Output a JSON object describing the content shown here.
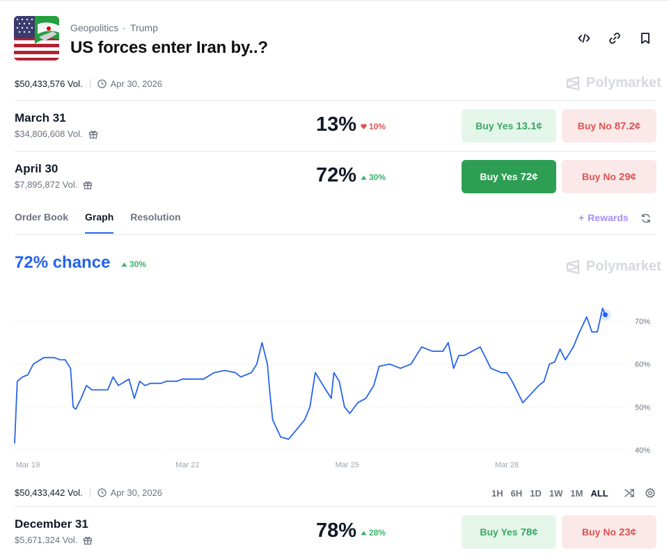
{
  "header": {
    "breadcrumb": [
      "Geopolitics",
      "Trump"
    ],
    "breadcrumb_separator": "·",
    "title": "US forces enter Iran by..?",
    "icons": [
      "embed-icon",
      "link-icon",
      "bookmark-icon"
    ]
  },
  "summary": {
    "volume": "$50,433,576 Vol.",
    "end_date": "Apr 30, 2026",
    "brand": "Polymarket"
  },
  "outcomes": [
    {
      "name": "March 31",
      "volume": "$34,806,608 Vol.",
      "chance": "13%",
      "change": "10%",
      "direction": "down",
      "buy_yes_label": "Buy Yes",
      "buy_yes_price": "13.1¢",
      "buy_no_label": "Buy No",
      "buy_no_price": "87.2¢",
      "selected": false
    },
    {
      "name": "April 30",
      "volume": "$7,895,872 Vol.",
      "chance": "72%",
      "change": "30%",
      "direction": "up",
      "buy_yes_label": "Buy Yes",
      "buy_yes_price": "72¢",
      "buy_no_label": "Buy No",
      "buy_no_price": "29¢",
      "selected": true
    },
    {
      "name": "December 31",
      "volume": "$5,671,324 Vol.",
      "chance": "78%",
      "change": "28%",
      "direction": "up",
      "buy_yes_label": "Buy Yes",
      "buy_yes_price": "78¢",
      "buy_no_label": "Buy No",
      "buy_no_price": "23¢",
      "selected": false
    }
  ],
  "tabs": {
    "items": [
      "Order Book",
      "Graph",
      "Resolution"
    ],
    "active": "Graph",
    "rewards_label": "Rewards"
  },
  "graph": {
    "chance_label": "72% chance",
    "change": "30%",
    "brand": "Polymarket",
    "volume": "$50,433,442 Vol.",
    "end_date": "Apr 30, 2026",
    "ranges": [
      "1H",
      "6H",
      "1D",
      "1W",
      "1M",
      "ALL"
    ],
    "active_range": "ALL"
  },
  "colors": {
    "accent": "#2563eb",
    "up": "#3bb36b",
    "down": "#e05252",
    "buy_yes_active": "#2f9e55",
    "rewards": "#a78bfa"
  },
  "chart_data": {
    "type": "line",
    "title": "",
    "xlabel": "",
    "ylabel": "",
    "x_ticks": [
      "Mar 19",
      "Mar 22",
      "Mar 25",
      "Mar 28"
    ],
    "y_ticks": [
      "40%",
      "50%",
      "60%",
      "70%"
    ],
    "ylim": [
      40,
      75
    ],
    "xlim": [
      18.75,
      30.25
    ],
    "grid": "horizontal dotted",
    "series": [
      {
        "x": [
          18.75,
          18.8,
          18.9,
          19.0,
          19.1,
          19.3,
          19.5,
          19.6,
          19.7,
          19.8,
          19.85,
          19.9,
          20.0,
          20.1,
          20.2,
          20.5,
          20.6,
          20.7,
          20.9,
          21.0,
          21.1,
          21.2,
          21.3,
          21.5,
          21.6,
          21.8,
          21.9,
          22.0,
          22.3,
          22.5,
          22.7,
          22.9,
          23.0,
          23.1,
          23.2,
          23.3,
          23.4,
          23.5,
          23.55,
          23.6,
          23.75,
          23.9,
          24.0,
          24.2,
          24.3,
          24.4,
          24.5,
          24.6,
          24.7,
          24.75,
          24.85,
          24.95,
          25.05,
          25.2,
          25.35,
          25.5,
          25.6,
          25.8,
          26.0,
          26.2,
          26.4,
          26.6,
          26.8,
          26.9,
          27.0,
          27.1,
          27.2,
          27.35,
          27.5,
          27.7,
          27.9,
          28.0,
          28.1,
          28.3,
          28.45,
          28.6,
          28.7,
          28.8,
          28.9,
          29.0,
          29.1,
          29.25,
          29.35,
          29.5,
          29.6,
          29.7,
          29.8,
          29.85
        ],
        "y": [
          41.5,
          56,
          57,
          57.5,
          60,
          61.5,
          61.5,
          61,
          61,
          59,
          50,
          49.5,
          52,
          55,
          54,
          54,
          57,
          55,
          56.5,
          52,
          56,
          55,
          55.5,
          55.5,
          56,
          56,
          56.5,
          56.5,
          56.5,
          58,
          58.5,
          58,
          57,
          57.5,
          58,
          60,
          65,
          60,
          53,
          47,
          43,
          42.5,
          44,
          47,
          50,
          58,
          56,
          54,
          52,
          58,
          56,
          50,
          48.5,
          51,
          52,
          55,
          59.5,
          60,
          59,
          60,
          64,
          63,
          63,
          65,
          59,
          62,
          62,
          63,
          64,
          59,
          58,
          58,
          56,
          51,
          53,
          55,
          56,
          60,
          60.5,
          63.5,
          61,
          64,
          67,
          71,
          67.5,
          67.5,
          73,
          71.5
        ]
      }
    ]
  }
}
